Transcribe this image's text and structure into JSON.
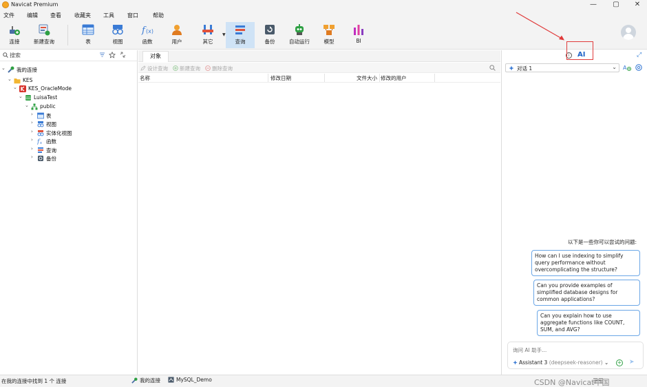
{
  "window": {
    "title": "Navicat Premium",
    "controls": {
      "minimize": "—",
      "maximize": "▢",
      "close": "✕"
    }
  },
  "menu": [
    "文件",
    "编辑",
    "查看",
    "收藏夹",
    "工具",
    "窗口",
    "帮助"
  ],
  "toolbar": {
    "items": [
      {
        "label": "连接",
        "icon": "connection-plug-icon"
      },
      {
        "label": "新建查询",
        "icon": "new-query-icon"
      },
      {
        "label": "表",
        "icon": "table-icon"
      },
      {
        "label": "视图",
        "icon": "view-glasses-icon"
      },
      {
        "label": "函数",
        "icon": "function-fx-icon"
      },
      {
        "label": "用户",
        "icon": "user-icon"
      },
      {
        "label": "其它",
        "icon": "tools-icon"
      },
      {
        "label": "查询",
        "icon": "query-icon"
      },
      {
        "label": "备份",
        "icon": "backup-icon"
      },
      {
        "label": "自动运行",
        "icon": "robot-icon"
      },
      {
        "label": "模型",
        "icon": "model-icon"
      },
      {
        "label": "BI",
        "icon": "bi-chart-icon"
      }
    ],
    "active": "查询"
  },
  "nav": {
    "search_placeholder": "搜索",
    "tree": [
      {
        "label": "我的连接",
        "level": 0,
        "expanded": true,
        "icon": "my-connections-icon"
      },
      {
        "label": "KES",
        "level": 1,
        "expanded": true,
        "icon": "folder-icon"
      },
      {
        "label": "KES_OracleMode",
        "level": 2,
        "expanded": true,
        "icon": "kes-server-icon"
      },
      {
        "label": "LuisaTest",
        "level": 3,
        "expanded": true,
        "icon": "database-icon"
      },
      {
        "label": "public",
        "level": 4,
        "expanded": true,
        "icon": "schema-icon"
      },
      {
        "label": "表",
        "level": 5,
        "expanded": false,
        "icon": "table-icon"
      },
      {
        "label": "视图",
        "level": 5,
        "expanded": false,
        "icon": "view-glasses-icon"
      },
      {
        "label": "实体化视图",
        "level": 5,
        "expanded": false,
        "icon": "materialized-view-icon"
      },
      {
        "label": "函数",
        "level": 5,
        "expanded": false,
        "icon": "function-fx-icon"
      },
      {
        "label": "查询",
        "level": 5,
        "expanded": false,
        "icon": "query-icon"
      },
      {
        "label": "备份",
        "level": 5,
        "expanded": false,
        "icon": "backup-icon"
      }
    ]
  },
  "objects": {
    "tab": "对象",
    "actions": [
      "设计查询",
      "新建查询",
      "删除查询"
    ],
    "columns": [
      "名称",
      "修改日期",
      "文件大小",
      "修改的用户"
    ]
  },
  "ai": {
    "tab_label": "AI",
    "conversation": "对话 1",
    "suggestions_title": "以下是一些你可以尝试的问题:",
    "suggestions": [
      "How can I use indexing to simplify query performance without overcomplicating the structure?",
      "Can you provide examples of simplified database designs for common applications?",
      "Can you explain how to use aggregate functions like COUNT, SUM, and AVG?"
    ],
    "input_placeholder": "询问 AI 助手...",
    "assistant_name": "Assistant 3",
    "assistant_model": "(deepseek-reasoner)"
  },
  "status": {
    "text": "在我的连接中找到 1 个 连接",
    "tabs": [
      "我的连接",
      "MySQL_Demo"
    ]
  },
  "watermark": "CSDN @Navicat中国",
  "colors": {
    "accent": "#1e63c7",
    "active_tool": "#cfe3f6",
    "suggestion_border": "#6aa6e6",
    "annotation": "#e03a3a"
  }
}
